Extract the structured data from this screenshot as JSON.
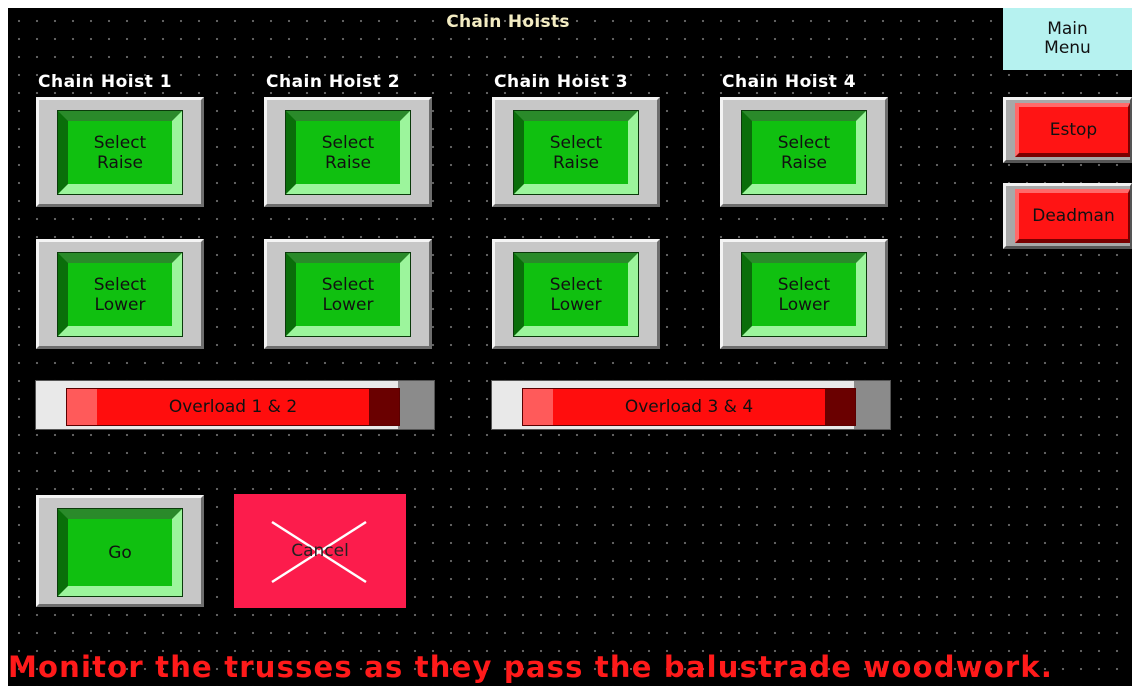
{
  "screen_title": "Chain Hoists",
  "hoists": [
    {
      "label": "Chain Hoist 1",
      "raise": "Select\nRaise",
      "lower": "Select\nLower"
    },
    {
      "label": "Chain Hoist 2",
      "raise": "Select\nRaise",
      "lower": "Select\nLower"
    },
    {
      "label": "Chain Hoist 3",
      "raise": "Select\nRaise",
      "lower": "Select\nLower"
    },
    {
      "label": "Chain Hoist 4",
      "raise": "Select\nRaise",
      "lower": "Select\nLower"
    }
  ],
  "raise_line1": "Select",
  "raise_line2": "Raise",
  "lower_line1": "Select",
  "lower_line2": "Lower",
  "overloads": [
    "Overload 1 & 2",
    "Overload 3 & 4"
  ],
  "go_label": "Go",
  "cancel_label": "Cancel",
  "main_menu": {
    "line1": "Main",
    "line2": "Menu"
  },
  "estop_label": "Estop",
  "deadman_label": "Deadman",
  "message": "Monitor the trusses as they pass the balustrade woodwork.",
  "colors": {
    "background": "#000000",
    "button_green": "#10c010",
    "alarm_red": "#ff1414",
    "cancel_pink": "#fc1c4c",
    "menu_cyan": "#b6f2f0",
    "message_red": "#ff1a1a"
  }
}
